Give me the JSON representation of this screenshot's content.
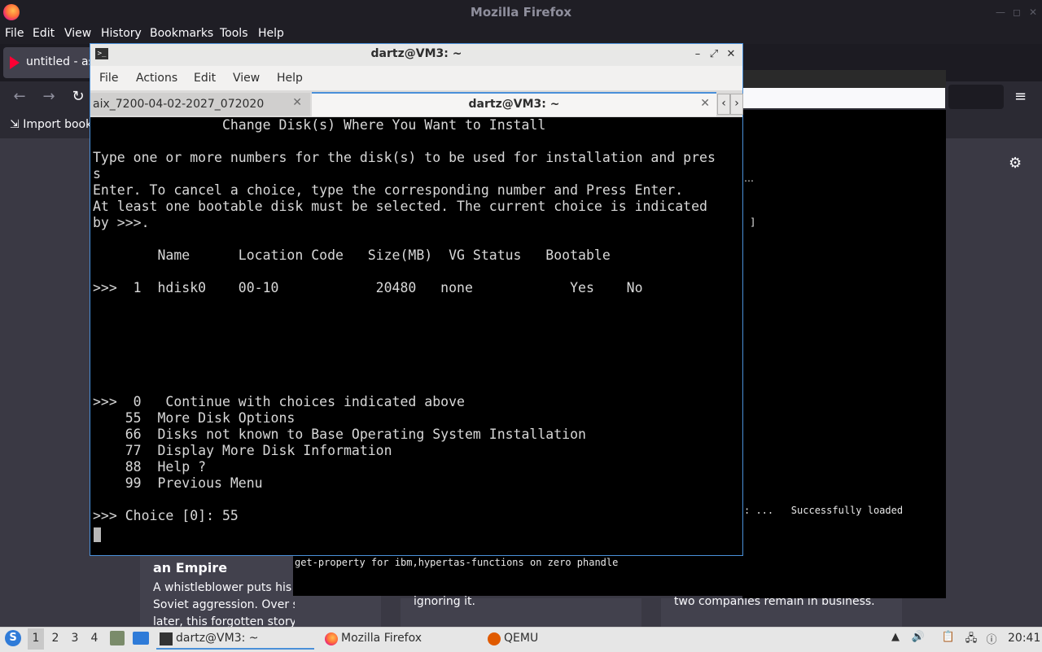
{
  "firefox": {
    "title": "Mozilla Firefox",
    "menu": [
      "File",
      "Edit",
      "View",
      "History",
      "Bookmarks",
      "Tools",
      "Help"
    ],
    "tab_label": "untitled - as",
    "bookmarks_item": "Import book",
    "menu_icon": "≡",
    "settings_icon": "⚙"
  },
  "articles": {
    "card1_title": "an Empire",
    "card1_text": "A whistleblower puts his lif to defy Soviet aggression. Over sixty years later, this forgotten story of…",
    "card2_text": "ignoring it.",
    "card3_text": "two companies remain in business."
  },
  "qemu": {
    "loaded_msg": ": ...   Successfully loaded",
    "strip_msg": "get-property for ibm,hypertas-functions on zero phandle",
    "dot1": "…",
    "dot2": "]"
  },
  "terminal": {
    "title": "dartz@VM3: ~",
    "menu": [
      "File",
      "Actions",
      "Edit",
      "View",
      "Help"
    ],
    "tab1_label": "aix_7200-04-02-2027_072020",
    "tab2_label": "dartz@VM3: ~",
    "lines": [
      "                Change Disk(s) Where You Want to Install",
      "",
      "Type one or more numbers for the disk(s) to be used for installation and pres",
      "s",
      "Enter. To cancel a choice, type the corresponding number and Press Enter.",
      "At least one bootable disk must be selected. The current choice is indicated",
      "by >>>.",
      "",
      "        Name      Location Code   Size(MB)  VG Status   Bootable",
      "",
      ">>>  1  hdisk0    00-10            20480   none            Yes    No",
      "",
      "",
      "",
      "",
      "",
      "",
      ">>>  0   Continue with choices indicated above",
      "    55  More Disk Options",
      "    66  Disks not known to Base Operating System Installation",
      "    77  Display More Disk Information",
      "    88  Help ?",
      "    99  Previous Menu",
      "",
      ">>> Choice [0]: 55"
    ]
  },
  "taskbar": {
    "workspaces": [
      "1",
      "2",
      "3",
      "4"
    ],
    "tasks": [
      "dartz@VM3: ~",
      "Mozilla Firefox",
      "QEMU"
    ],
    "clock": "20:41"
  }
}
